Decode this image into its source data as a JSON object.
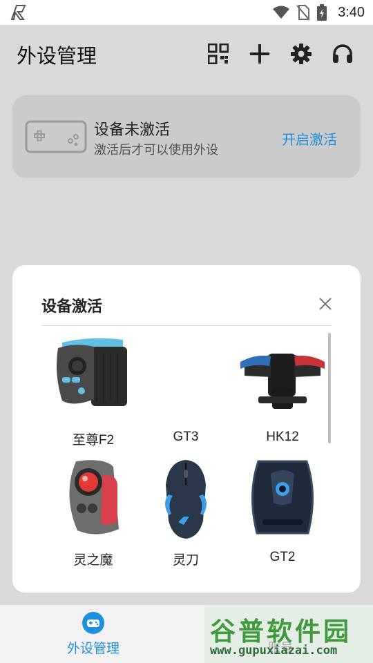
{
  "status_bar": {
    "time": "3:40",
    "icons": [
      "app-logo-icon",
      "wifi-icon",
      "no-sim-icon",
      "battery-charging-icon"
    ]
  },
  "app_bar": {
    "title": "外设管理",
    "actions": [
      "qr-scan-icon",
      "add-icon",
      "settings-gear-icon",
      "headset-support-icon"
    ]
  },
  "activation_card": {
    "title": "设备未激活",
    "subtitle": "激活后才可以使用外设",
    "action_label": "开启激活"
  },
  "dialog": {
    "title": "设备激活",
    "devices": [
      {
        "name": "至尊F2"
      },
      {
        "name": "GT3"
      },
      {
        "name": "HK12"
      },
      {
        "name": "灵之魔"
      },
      {
        "name": "灵刀"
      },
      {
        "name": "GT2"
      }
    ]
  },
  "bottom_nav": {
    "items": [
      {
        "label": "外设管理",
        "icon": "gamepad-icon"
      }
    ],
    "partial_label": "账号"
  },
  "watermark": {
    "brand": "谷普软件园",
    "url": "www.gupuxiazai.com"
  },
  "colors": {
    "accent": "#1f8fe0",
    "background": "#d9d9d9",
    "card": "#cbcbcb"
  }
}
